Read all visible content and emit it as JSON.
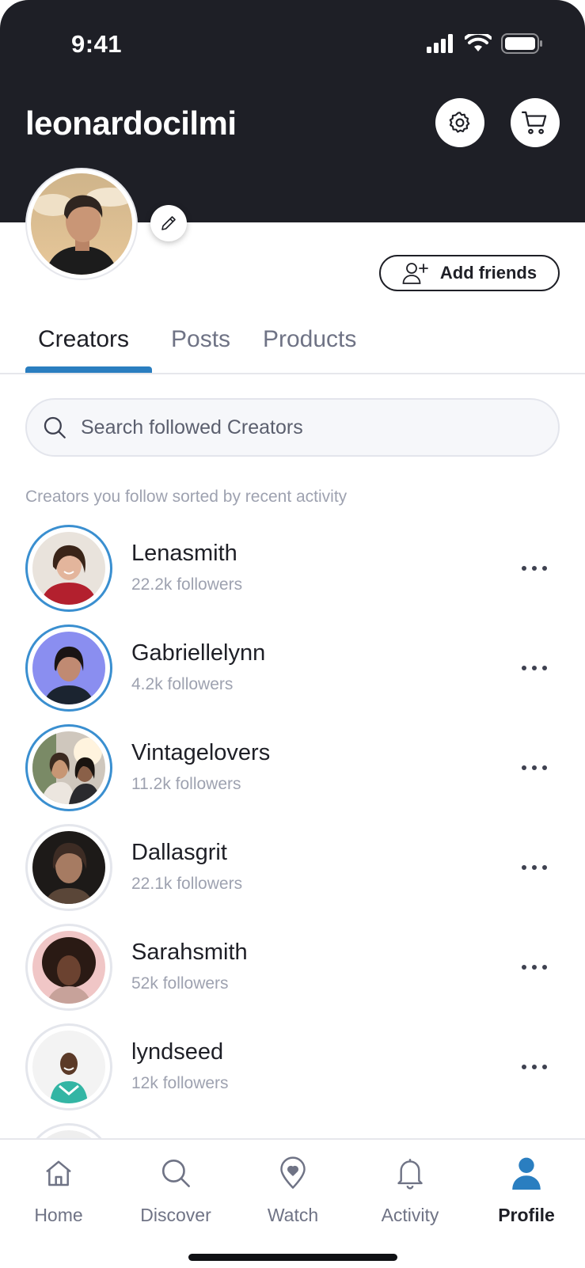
{
  "status_bar": {
    "time": "9:41"
  },
  "header": {
    "username": "leonardocilmi",
    "settings_icon": "gear-icon",
    "cart_icon": "cart-icon"
  },
  "profile": {
    "add_friends_label": "Add friends"
  },
  "tabs": [
    {
      "label": "Creators",
      "active": true
    },
    {
      "label": "Posts",
      "active": false
    },
    {
      "label": "Products",
      "active": false
    }
  ],
  "search": {
    "placeholder": "Search followed Creators"
  },
  "section_hint": "Creators you follow sorted by recent activity",
  "creators": [
    {
      "name": "Lenasmith",
      "followers": "22.2k followers",
      "story": true
    },
    {
      "name": "Gabriellelynn",
      "followers": "4.2k followers",
      "story": true
    },
    {
      "name": "Vintagelovers",
      "followers": "11.2k followers",
      "story": true
    },
    {
      "name": "Dallasgrit",
      "followers": "22.1k followers",
      "story": false
    },
    {
      "name": "Sarahsmith",
      "followers": "52k followers",
      "story": false
    },
    {
      "name": "lyndseed",
      "followers": "12k followers",
      "story": false
    }
  ],
  "tabbar": [
    {
      "label": "Home",
      "icon": "home-icon",
      "active": false
    },
    {
      "label": "Discover",
      "icon": "search-icon",
      "active": false
    },
    {
      "label": "Watch",
      "icon": "location-heart-icon",
      "active": false
    },
    {
      "label": "Activity",
      "icon": "bell-icon",
      "active": false
    },
    {
      "label": "Profile",
      "icon": "person-icon",
      "active": true
    }
  ],
  "colors": {
    "header_bg": "#1e1f26",
    "accent": "#2a7ec0",
    "text_primary": "#1e1f26",
    "text_secondary": "#9ea2b0"
  }
}
